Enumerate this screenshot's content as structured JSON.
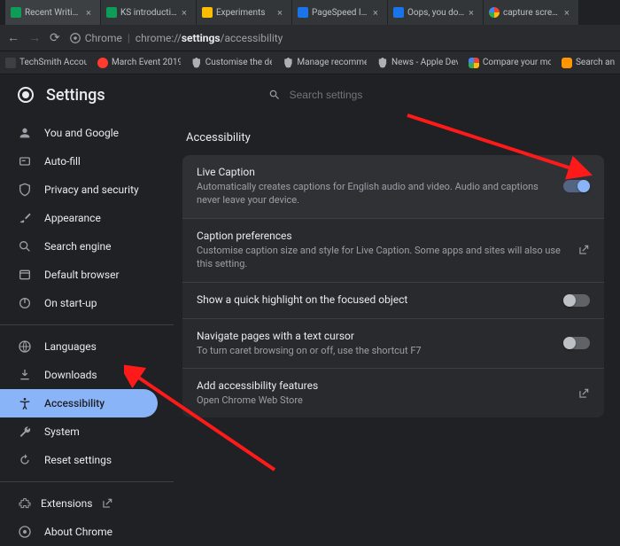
{
  "tabs": [
    {
      "title": "Recent Writing -",
      "fav": "favc-g"
    },
    {
      "title": "KS introduction S",
      "fav": "favc-g"
    },
    {
      "title": "Experiments",
      "fav": "favc-y"
    },
    {
      "title": "PageSpeed Insig",
      "fav": "favc-b"
    },
    {
      "title": "Oops, you don't h",
      "fav": "favc-b"
    },
    {
      "title": "capture screensh",
      "fav": "favc-c"
    }
  ],
  "toolbar": {
    "host": "Chrome",
    "path": "chrome://settings/accessibility",
    "path_prefix": "chrome://",
    "path_bold": "settings",
    "path_suffix": "/accessibility"
  },
  "bookmarks": [
    {
      "label": "TechSmith Accou…",
      "icon": ""
    },
    {
      "label": "March Event 2019…",
      "icon": "bico-red"
    },
    {
      "label": "Customise the de…",
      "icon": "bico-ap"
    },
    {
      "label": "Manage recomme…",
      "icon": "bico-ap"
    },
    {
      "label": "News - Apple Dev…",
      "icon": "bico-ap"
    },
    {
      "label": "Compare your mo…",
      "icon": "bico-go"
    },
    {
      "label": "Search and",
      "icon": "bico-or"
    }
  ],
  "header": {
    "title": "Settings",
    "search_placeholder": "Search settings"
  },
  "sidebar": {
    "top": [
      {
        "label": "You and Google",
        "icon": "person"
      },
      {
        "label": "Auto-fill",
        "icon": "autofill"
      },
      {
        "label": "Privacy and security",
        "icon": "shield"
      },
      {
        "label": "Appearance",
        "icon": "brush"
      },
      {
        "label": "Search engine",
        "icon": "search"
      },
      {
        "label": "Default browser",
        "icon": "browser"
      },
      {
        "label": "On start-up",
        "icon": "power"
      }
    ],
    "mid": [
      {
        "label": "Languages",
        "icon": "globe"
      },
      {
        "label": "Downloads",
        "icon": "download"
      },
      {
        "label": "Accessibility",
        "icon": "accessibility",
        "selected": true
      },
      {
        "label": "System",
        "icon": "wrench"
      },
      {
        "label": "Reset settings",
        "icon": "reset"
      }
    ],
    "bottom": [
      {
        "label": "Extensions",
        "icon": "extension",
        "ext": true
      },
      {
        "label": "About Chrome",
        "icon": "chrome"
      }
    ]
  },
  "section": {
    "title": "Accessibility"
  },
  "rows": [
    {
      "title": "Live Caption",
      "sub": "Automatically creates captions for English audio and video. Audio and captions never leave your device.",
      "control": "toggle",
      "on": true,
      "highlight": true
    },
    {
      "title": "Caption preferences",
      "sub": "Customise caption size and style for Live Caption. Some apps and sites will also use this setting.",
      "control": "link"
    },
    {
      "title": "Show a quick highlight on the focused object",
      "sub": "",
      "control": "toggle",
      "on": false
    },
    {
      "title": "Navigate pages with a text cursor",
      "sub": "To turn caret browsing on or off, use the shortcut F7",
      "control": "toggle",
      "on": false
    },
    {
      "title": "Add accessibility features",
      "sub": "Open Chrome Web Store",
      "control": "link"
    }
  ]
}
